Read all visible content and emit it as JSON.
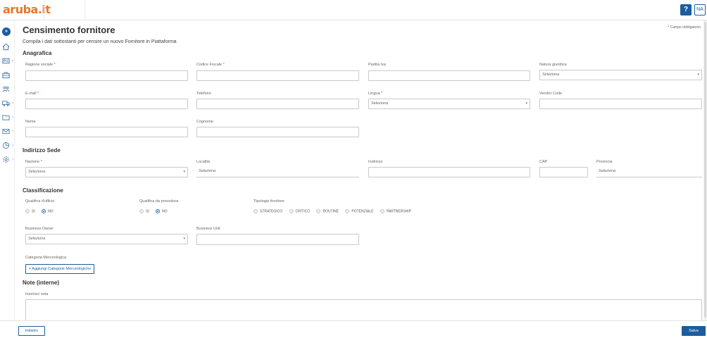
{
  "header": {
    "logo": "aruba.it",
    "help_label": "?",
    "user_initials": "NA"
  },
  "sidebar": {
    "expand_icon": "»",
    "items": [
      {
        "icon": "home-icon"
      },
      {
        "icon": "id-card-icon"
      },
      {
        "icon": "briefcase-icon"
      },
      {
        "icon": "users-icon"
      },
      {
        "icon": "truck-icon"
      },
      {
        "icon": "folder-icon"
      },
      {
        "icon": "mail-icon"
      },
      {
        "icon": "chart-icon"
      },
      {
        "icon": "gear-icon"
      }
    ]
  },
  "page": {
    "title": "Censimento fornitore",
    "required_note": "Campo obbligatorio",
    "subtitle": "Compila i dati sottostanti per censire un nuovo Fornitore in Piattaforma"
  },
  "anagrafica": {
    "title": "Anagrafica",
    "ragione_sociale": "Ragione sociale",
    "codice_fiscale": "Codice Fiscale",
    "partita_iva": "Partita Iva",
    "natura_giuridica": "Natura giuridica",
    "natura_giuridica_value": "Seleziona",
    "email": "E-mail",
    "telefono": "Telefono",
    "lingua": "Lingua",
    "lingua_value": "Seleziona",
    "vendor_code": "Vendor Code",
    "nome": "Nome",
    "cognome": "Cognome"
  },
  "indirizzo": {
    "title": "Indirizzo Sede",
    "nazione": "Nazione",
    "nazione_value": "Seleziona",
    "localita": "Località",
    "localita_value": "Seleziona",
    "indirizzo": "Indirizzo",
    "cap": "CAP",
    "provincia": "Provincia",
    "provincia_value": "Seleziona"
  },
  "classificazione": {
    "title": "Classificazione",
    "qualifica_ufficio": "Qualifica d'ufficio",
    "qualifica_procedura": "Qualifica da procedura",
    "tipologia": "Tipologia fornitore",
    "si": "SI",
    "no": "NO",
    "tipologia_options": [
      "STRATEGICO",
      "CRITICO",
      "ROUTINE",
      "POTENZIALE",
      "PARTNERSHIP"
    ],
    "business_owner": "Business Owner",
    "business_owner_value": "Seleziona",
    "business_unit": "Business Unit",
    "categoria": "Categoria Merceologica",
    "add_categoria": "+ Aggiungi Categorie Merceologiche"
  },
  "note": {
    "title": "Note (interne)",
    "inserisci": "Inserisci nota"
  },
  "footer": {
    "back": "Indietro",
    "save": "Salva"
  },
  "colors": {
    "accent": "#1c5d9e",
    "logo": "#e8782a",
    "required": "#dd3333"
  }
}
